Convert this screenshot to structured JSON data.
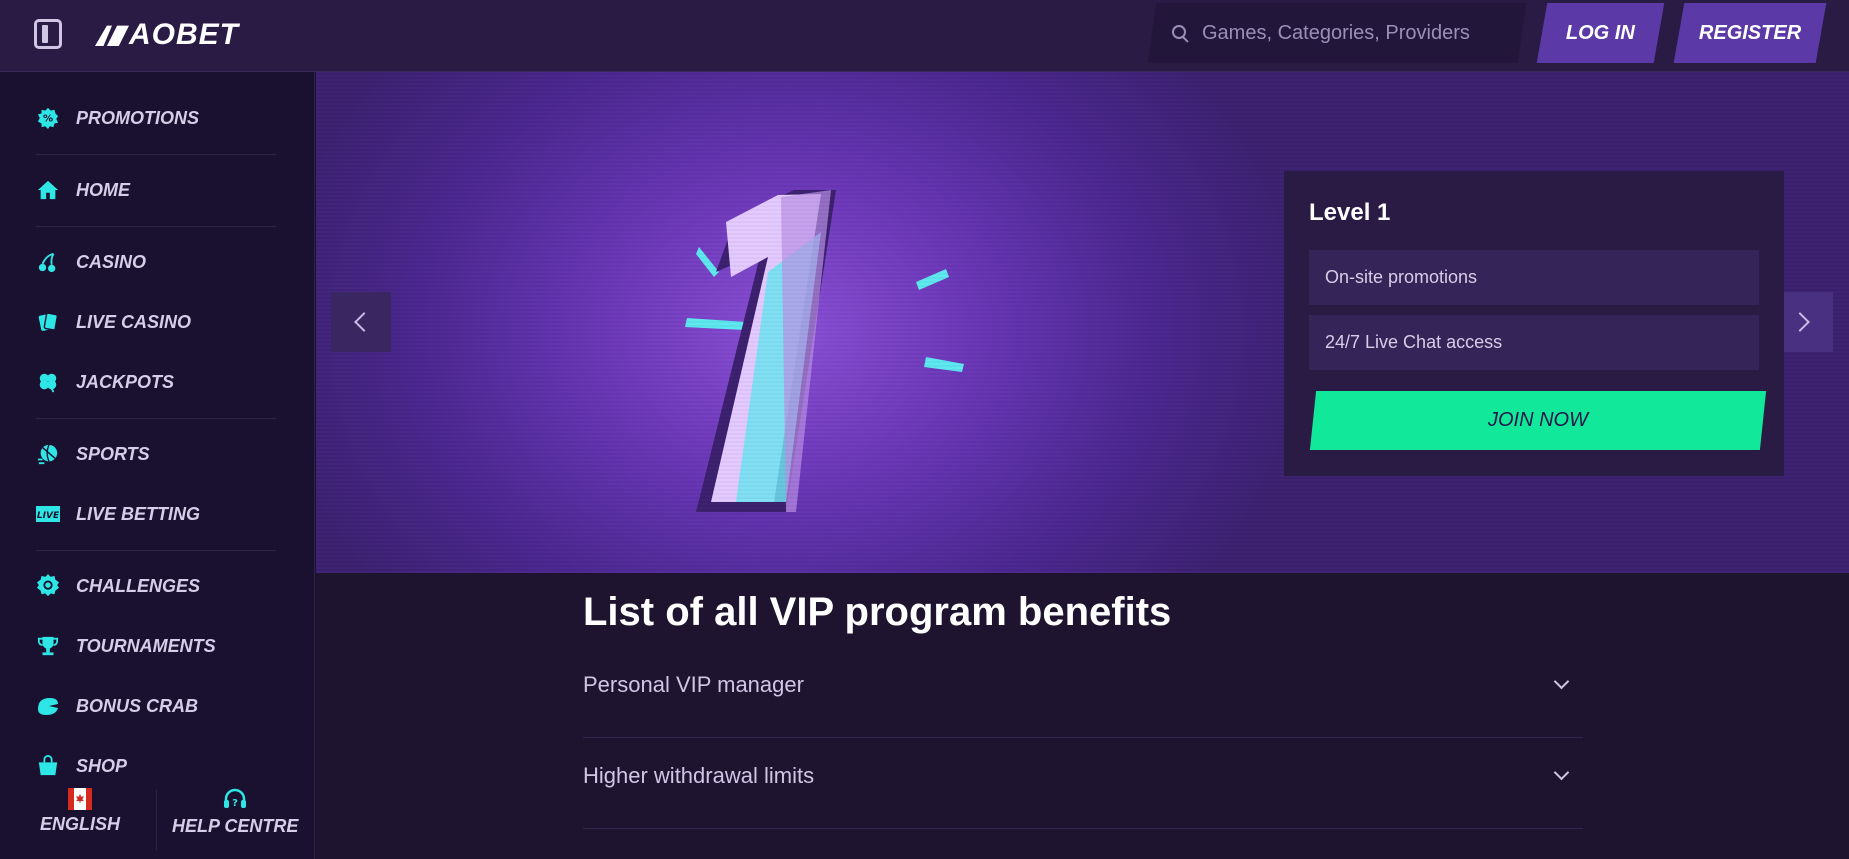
{
  "header": {
    "logo_text": "AOBET",
    "search_placeholder": "Games, Categories, Providers",
    "login_label": "LOG IN",
    "register_label": "REGISTER"
  },
  "sidebar": {
    "items": [
      {
        "label": "PROMOTIONS",
        "icon": "promotions-icon"
      },
      {
        "label": "HOME",
        "icon": "home-icon"
      },
      {
        "label": "CASINO",
        "icon": "cherries-icon"
      },
      {
        "label": "LIVE CASINO",
        "icon": "cards-icon"
      },
      {
        "label": "JACKPOTS",
        "icon": "clover-icon"
      },
      {
        "label": "SPORTS",
        "icon": "sports-ball-icon"
      },
      {
        "label": "LIVE BETTING",
        "icon": "live-badge-icon"
      },
      {
        "label": "CHALLENGES",
        "icon": "medal-icon"
      },
      {
        "label": "TOURNAMENTS",
        "icon": "trophy-icon"
      },
      {
        "label": "BONUS CRAB",
        "icon": "crab-icon"
      },
      {
        "label": "SHOP",
        "icon": "shopping-bag-icon"
      }
    ],
    "live_badge_text": "LIVE",
    "language_label": "ENGLISH",
    "help_label": "HELP CENTRE"
  },
  "hero": {
    "level_title": "Level 1",
    "perks": [
      "On-site promotions",
      "24/7 Live Chat access"
    ],
    "join_label": "JOIN NOW"
  },
  "benefits": {
    "title": "List of all VIP program benefits",
    "items": [
      "Personal VIP manager",
      "Higher withdrawal limits"
    ]
  },
  "colors": {
    "accent_cyan": "#2ee6e6",
    "join_green": "#12e89a",
    "button_purple": "#5b3aa8",
    "background": "#1e1430"
  }
}
